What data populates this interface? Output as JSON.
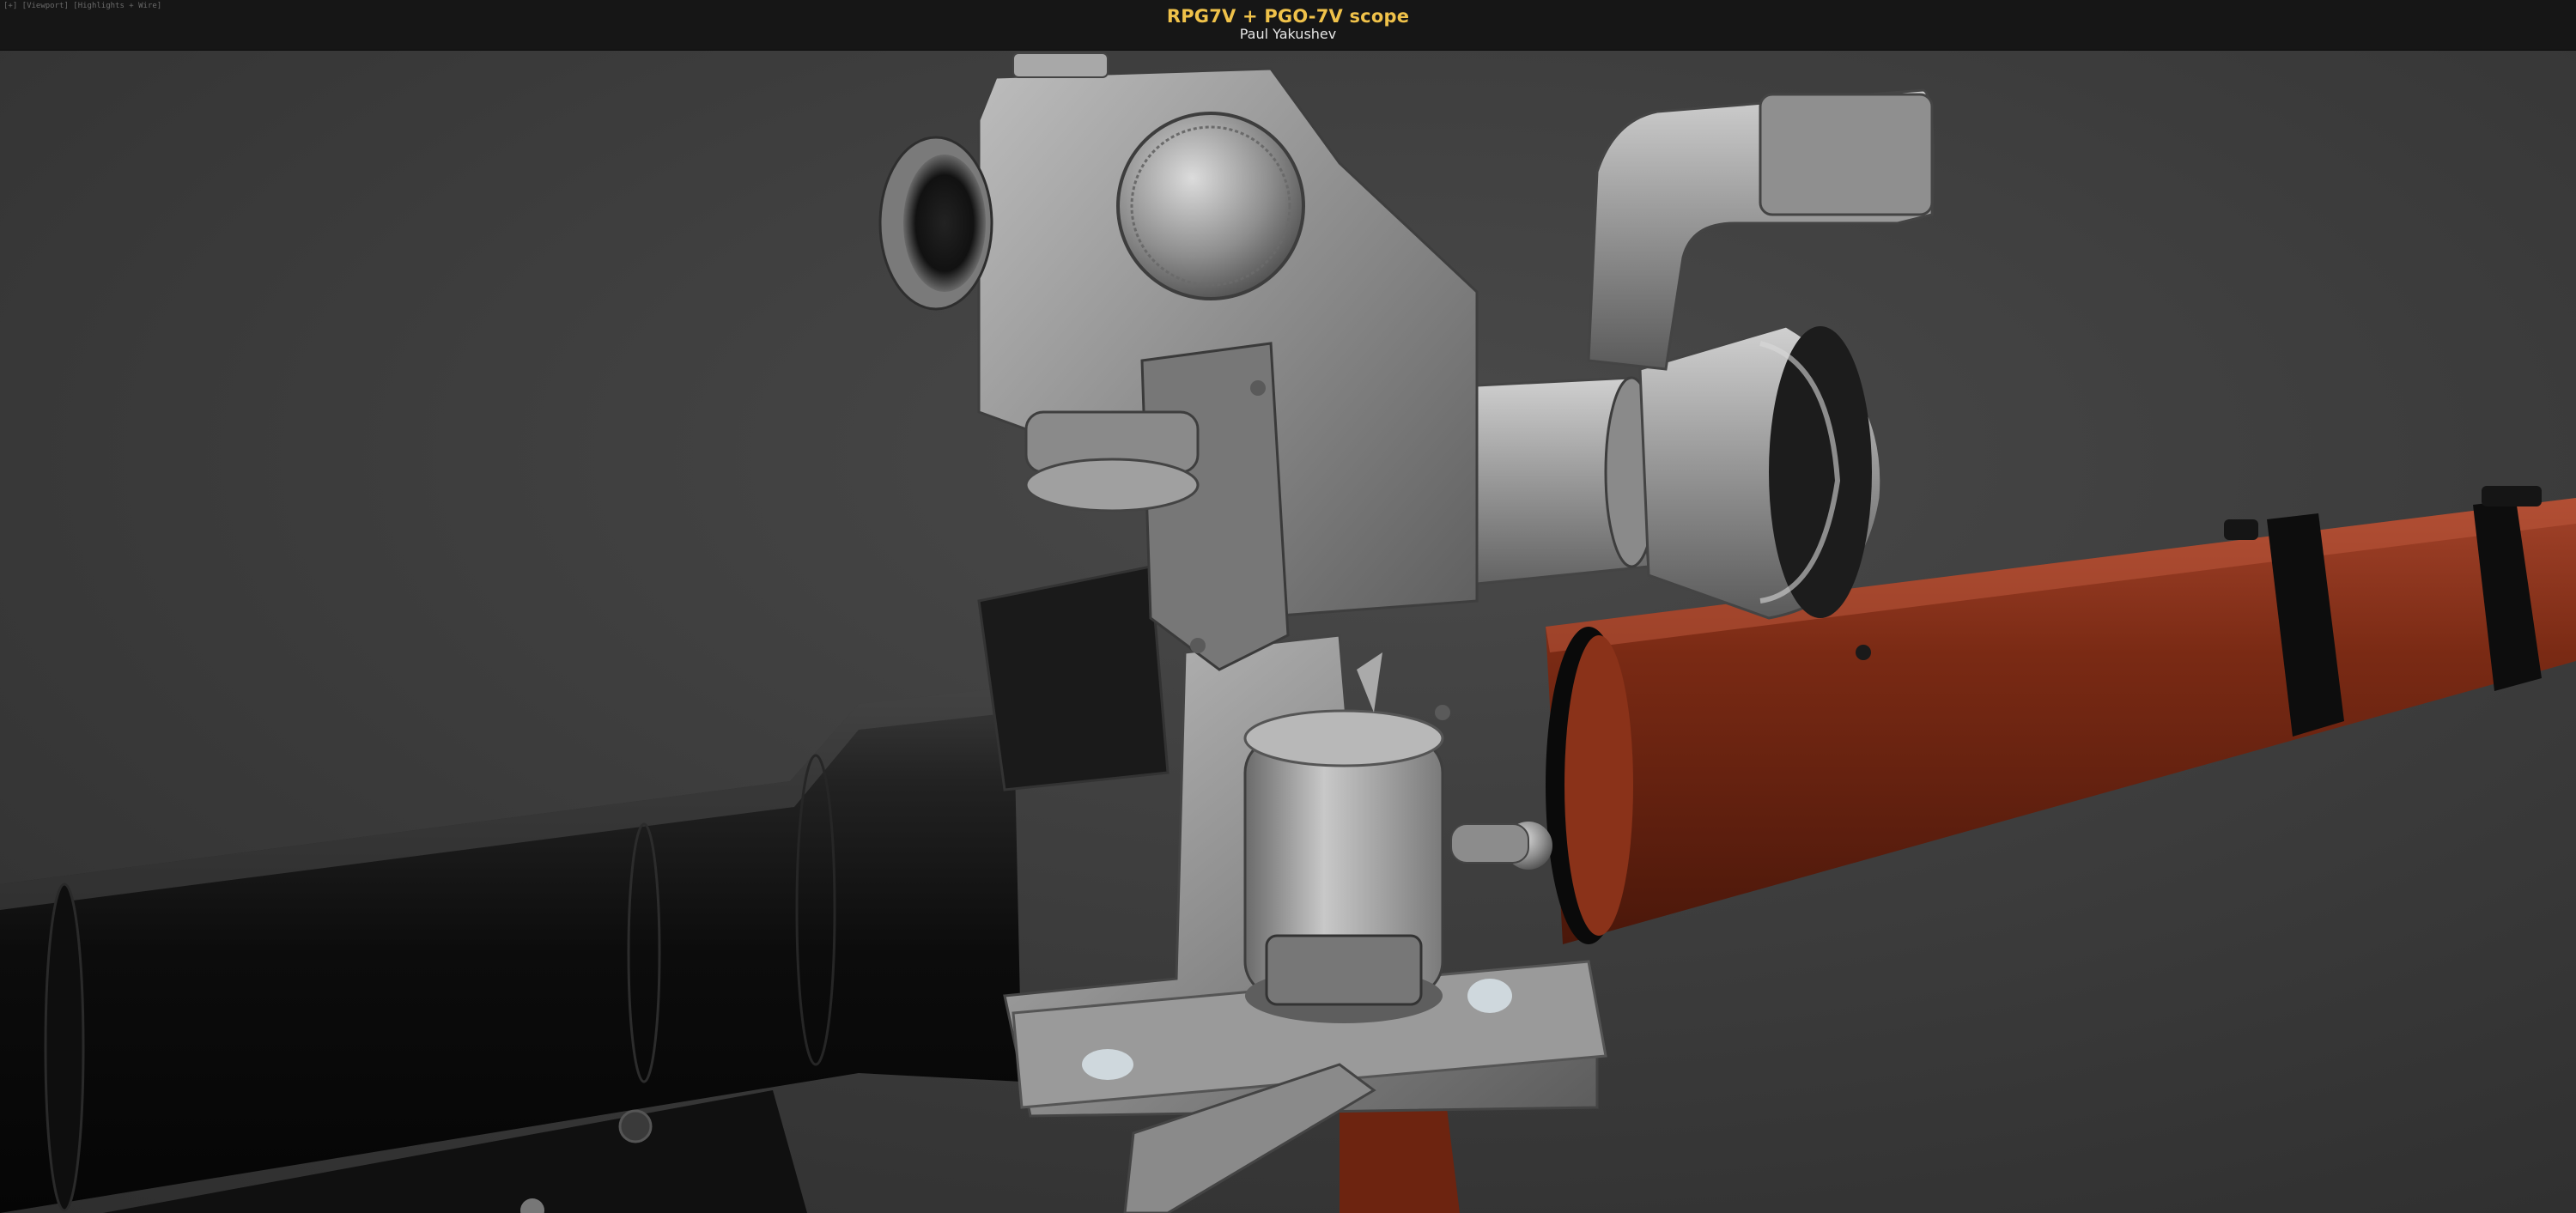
{
  "viewer": {
    "corner_label": "[+] [Viewport] [Highlights + Wire]",
    "title": "RPG7V + PGO-7V scope",
    "author": "Paul Yakushev"
  },
  "scene": {
    "background_color": "#3a3a3a",
    "tube_color": "#121212",
    "wood_color": "#7a2a14",
    "metal_color": "#8f8f8f"
  }
}
